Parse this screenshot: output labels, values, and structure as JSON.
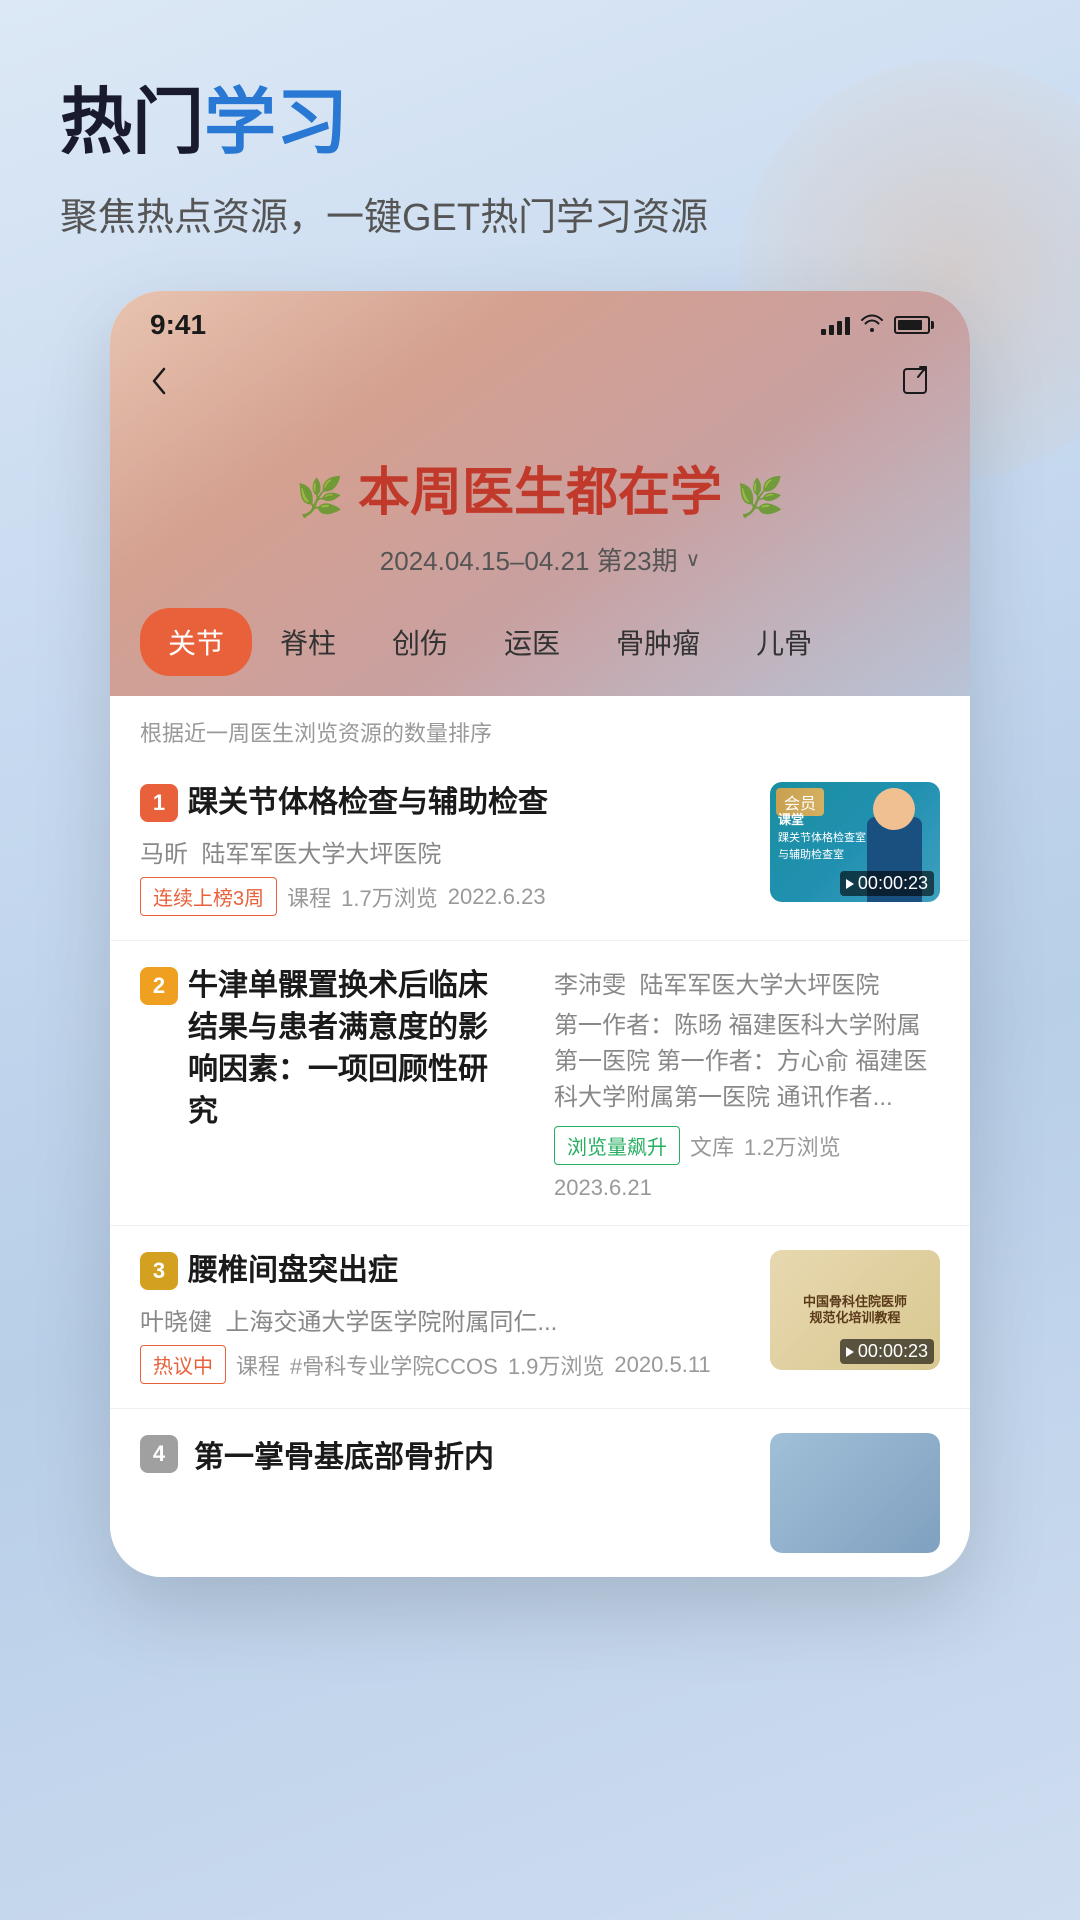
{
  "page": {
    "background": "gradient-blue",
    "decorative_circle": true
  },
  "header": {
    "main_title_part1": "热门",
    "main_title_part2": "学习",
    "subtitle": "聚焦热点资源，一键GET热门学习资源"
  },
  "phone": {
    "status_bar": {
      "time": "9:41",
      "signal": "full",
      "wifi": true,
      "battery": "full"
    },
    "nav": {
      "back_label": "‹",
      "share_label": "⤴"
    },
    "banner": {
      "laurel_left": "❧",
      "title": "本周医生都在学",
      "laurel_right": "❧",
      "date_range": "2024.04.15–04.21 第23期",
      "date_arrow": "∨"
    },
    "categories": [
      {
        "id": "guanjie",
        "label": "关节",
        "active": true
      },
      {
        "id": "jizhu",
        "label": "脊柱",
        "active": false
      },
      {
        "id": "chuangshang",
        "label": "创伤",
        "active": false
      },
      {
        "id": "yunyi",
        "label": "运医",
        "active": false
      },
      {
        "id": "guzhongliu",
        "label": "骨肿瘤",
        "active": false
      },
      {
        "id": "ergu",
        "label": "儿骨",
        "active": false
      }
    ],
    "ranking_note": "根据近一周医生浏览资源的数量排序",
    "items": [
      {
        "rank": 1,
        "title": "踝关节体格检查与辅助检查",
        "author": "马昕",
        "hospital": "陆军军医大学大坪医院",
        "tags": [
          {
            "text": "连续上榜3周",
            "type": "orange"
          },
          {
            "text": "课程",
            "type": "plain"
          }
        ],
        "views": "1.7万浏览",
        "date": "2022.6.23",
        "has_thumb": true,
        "thumb_type": "video",
        "member_badge": "会员",
        "duration": "00:00:23",
        "thumb_label": "课堂",
        "thumb_sublabel": "踝关节体格检查室\n与辅助检查室"
      },
      {
        "rank": 2,
        "title": "牛津单髁置换术后临床结果与患者满意度的影响因素：一项回顾性研究",
        "author": "李沛雯",
        "hospital": "陆军军医大学大坪医院",
        "desc": "第一作者：陈旸 福建医科大学附属第一医院 第一作者：方心俞 福建医科大学附属第一医院 通讯作者...",
        "tags": [
          {
            "text": "浏览量飙升",
            "type": "green"
          },
          {
            "text": "文库",
            "type": "plain"
          }
        ],
        "views": "1.2万浏览",
        "date": "2023.6.21",
        "has_thumb": false
      },
      {
        "rank": 3,
        "title": "腰椎间盘突出症",
        "author": "叶晓健",
        "hospital": "上海交通大学医学院附属同仁...",
        "tags": [
          {
            "text": "热议中",
            "type": "orange"
          },
          {
            "text": "课程",
            "type": "plain"
          },
          {
            "text": "#骨科专业学院CCOS",
            "type": "tag"
          },
          {
            "text": "1.9万浏览",
            "type": "plain"
          },
          {
            "text": "2020.5.11",
            "type": "plain"
          }
        ],
        "has_thumb": true,
        "thumb_type": "book",
        "duration": "00:00:23"
      },
      {
        "rank": 4,
        "title": "第一掌骨基底部骨折内",
        "has_thumb": true,
        "thumb_type": "video4",
        "partial": true
      }
    ]
  }
}
